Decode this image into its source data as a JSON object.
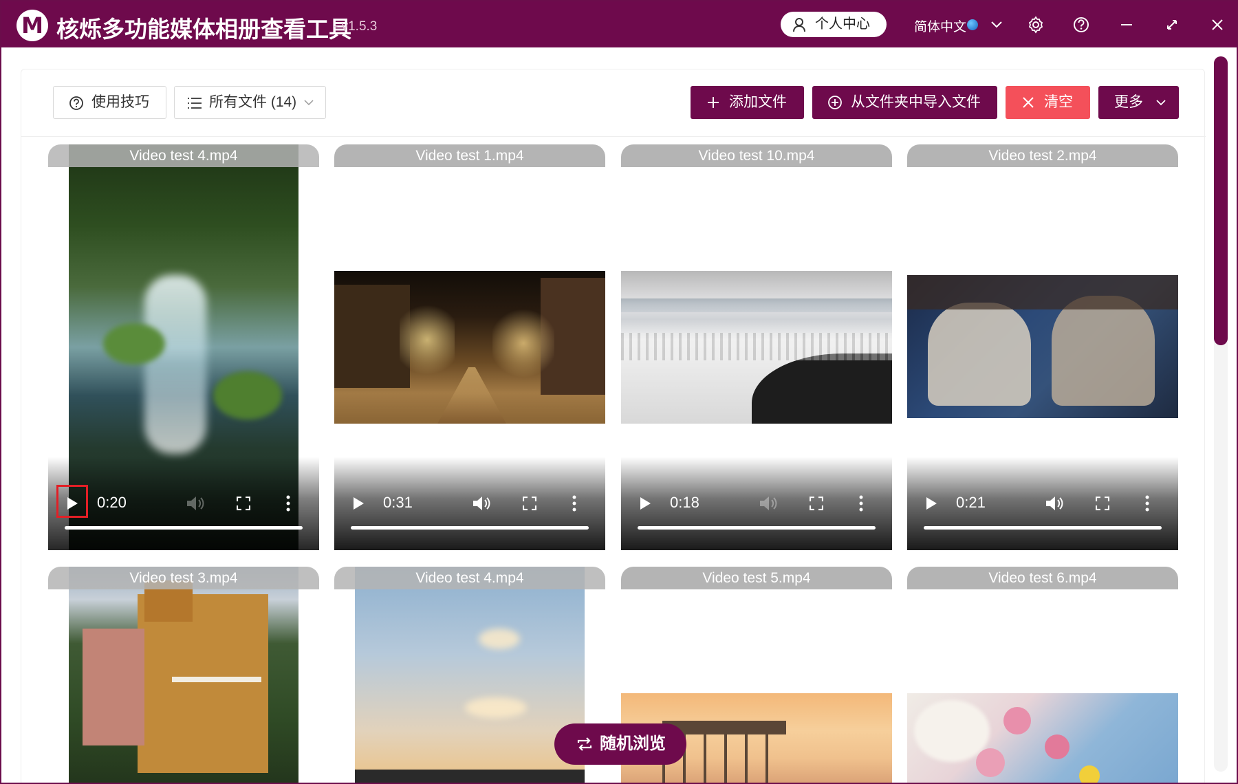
{
  "titlebar": {
    "logo_letter": "M",
    "title": "核烁多功能媒体相册查看工具",
    "version": "- v1.5.3",
    "user_center": "个人中心",
    "language": "简体中文",
    "color": "#6e0a4c"
  },
  "toolbar": {
    "tips_label": "使用技巧",
    "filter_label": "所有文件 (14)",
    "add_files_label": "添加文件",
    "import_folder_label": "从文件夹中导入文件",
    "clear_label": "清空",
    "more_label": "更多"
  },
  "videos": [
    {
      "name": "Video test 4.mp4",
      "time": "0:20",
      "scene": "waterfall"
    },
    {
      "name": "Video test 1.mp4",
      "time": "0:31",
      "scene": "night-street"
    },
    {
      "name": "Video test 10.mp4",
      "time": "0:18",
      "scene": "snow-coast"
    },
    {
      "name": "Video test 2.mp4",
      "time": "0:21",
      "scene": "men-reading"
    },
    {
      "name": "Video test 3.mp4",
      "scene": "villa"
    },
    {
      "name": "Video test 4.mp4",
      "scene": "birds-sky"
    },
    {
      "name": "Video test 5.mp4",
      "scene": "pier-sunset"
    },
    {
      "name": "Video test 6.mp4",
      "scene": "flowers"
    }
  ],
  "shuffle_label": "随机浏览",
  "colors": {
    "accent": "#6e0a4c",
    "danger": "#f4505a",
    "header_gray": "#b4b4b4"
  }
}
